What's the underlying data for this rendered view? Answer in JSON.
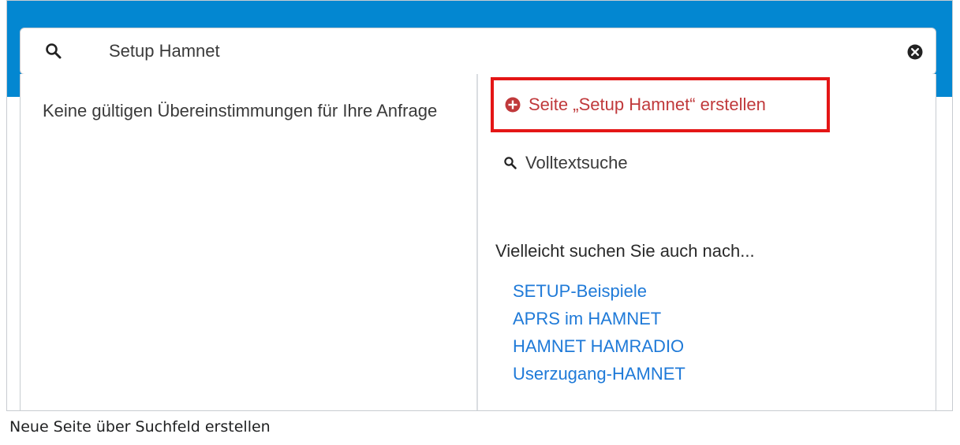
{
  "search": {
    "value": "Setup Hamnet"
  },
  "results": {
    "no_results_text": "Keine gültigen Übereinstimmungen für Ihre Anfrage"
  },
  "actions": {
    "create_page_label": "Seite „Setup Hamnet“ erstellen",
    "fulltext_label": "Volltextsuche"
  },
  "suggestions": {
    "heading": "Vielleicht suchen Sie auch nach...",
    "items": [
      "SETUP-Beispiele",
      "APRS im HAMNET",
      "HAMNET HAMRADIO",
      "Userzugang-HAMNET"
    ]
  },
  "caption": "Neue Seite über Suchfeld erstellen",
  "colors": {
    "header_blue": "#0387d1",
    "highlight_red": "#e41616",
    "create_text": "#c0393b",
    "link_blue": "#1f7ad8"
  },
  "icons": [
    "search-icon",
    "clear-icon",
    "plus-circle-icon",
    "fulltext-search-icon"
  ]
}
